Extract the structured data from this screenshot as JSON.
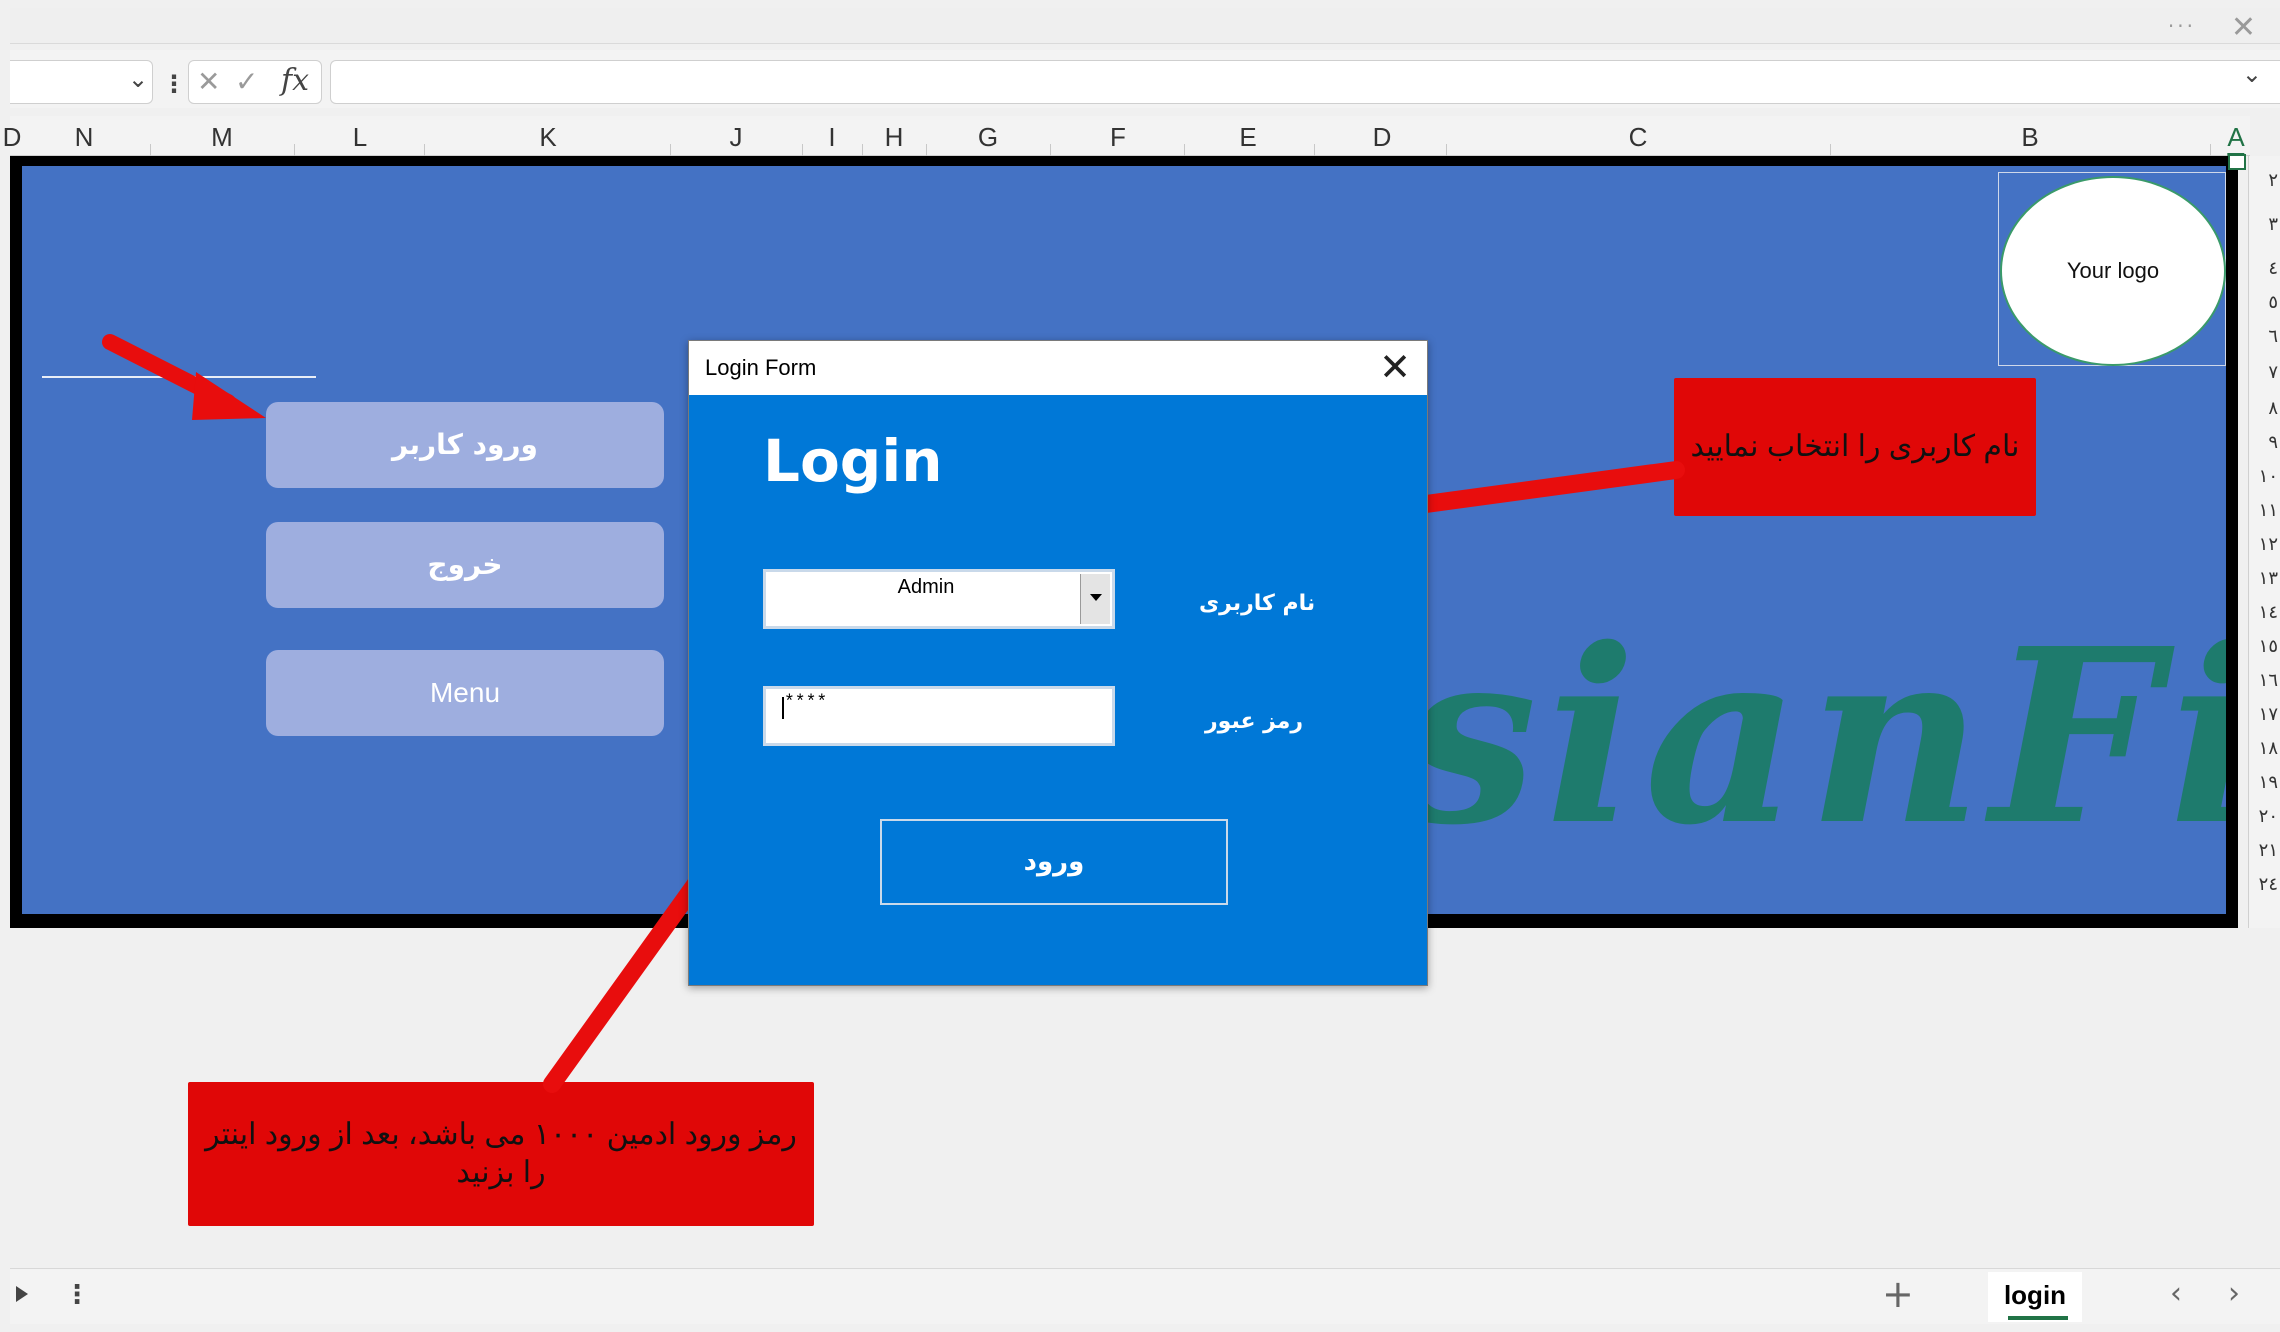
{
  "titlebar": {
    "more_glyph": "···",
    "close_glyph": "✕"
  },
  "formula_bar": {
    "fx_label": "fx",
    "cancel_glyph": "✕",
    "enter_glyph": "✓",
    "separator_glyph": "⋮",
    "chevron_glyph": "⌄"
  },
  "columns": [
    "D",
    "N",
    "M",
    "L",
    "K",
    "J",
    "I",
    "H",
    "G",
    "F",
    "E",
    "D",
    "C",
    "B",
    "A"
  ],
  "rows": [
    "٢",
    "٣",
    "٤",
    "٥",
    "٦",
    "٧",
    "٨",
    "٩",
    "١٠",
    "١١",
    "١٢",
    "١٣",
    "١٤",
    "١٥",
    "١٦",
    "١٧",
    "١٨",
    "١٩",
    "٢٠",
    "٢١",
    "٢٤"
  ],
  "sheet": {
    "watermark": "sianFi",
    "buttons": {
      "user_login": "ورود کاربر",
      "exit": "خروج",
      "menu": "Menu"
    },
    "logo": "Your logo",
    "callout_user": "نام کاربری را انتخاب نمایید",
    "callout_pass": "رمز ورود ادمین ۱۰۰۰ می باشد، بعد از ورود اینتر را بزنید"
  },
  "dialog": {
    "title": "Login Form",
    "close_glyph": "✕",
    "heading": "Login",
    "username_label": "نام کاربری",
    "username_value": "Admin",
    "password_label": "رمز عبور",
    "password_value": "****",
    "submit_label": "ورود"
  },
  "tabs": {
    "active": "login",
    "add_glyph": "+",
    "prev_glyph": "‹",
    "next_glyph": "›",
    "more_glyph": "⋮"
  },
  "colors": {
    "sheet_bg": "#4472c4",
    "dialog_bg": "#0078d7",
    "callout_bg": "#e00707",
    "arrow": "#e80d0d",
    "accent": "#217346"
  }
}
